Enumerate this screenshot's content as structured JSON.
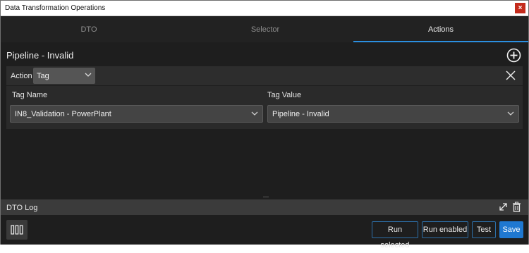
{
  "window": {
    "title": "Data Transformation Operations",
    "close_glyph": "×"
  },
  "tabs": [
    {
      "label": "DTO",
      "active": false
    },
    {
      "label": "Selector",
      "active": false
    },
    {
      "label": "Actions",
      "active": true
    }
  ],
  "pipeline": {
    "title": "Pipeline - Invalid"
  },
  "action": {
    "label": "Action",
    "selected": "Tag"
  },
  "tag_fields": {
    "name_label": "Tag Name",
    "name_value": "IN8_Validation - PowerPlant",
    "value_label": "Tag Value",
    "value_value": "Pipeline - Invalid"
  },
  "log": {
    "title": "DTO Log"
  },
  "footer": {
    "run_selected": "Run selected",
    "run_enabled": "Run enabled",
    "test": "Test",
    "save": "Save"
  },
  "colors": {
    "accent": "#2b8fe0",
    "save_button": "#1f78d1",
    "close_button": "#c42b1c"
  },
  "icons": [
    "close-icon",
    "add-circle-icon",
    "chevron-down-icon",
    "remove-x-icon",
    "expand-icon",
    "trash-icon",
    "columns-icon"
  ]
}
